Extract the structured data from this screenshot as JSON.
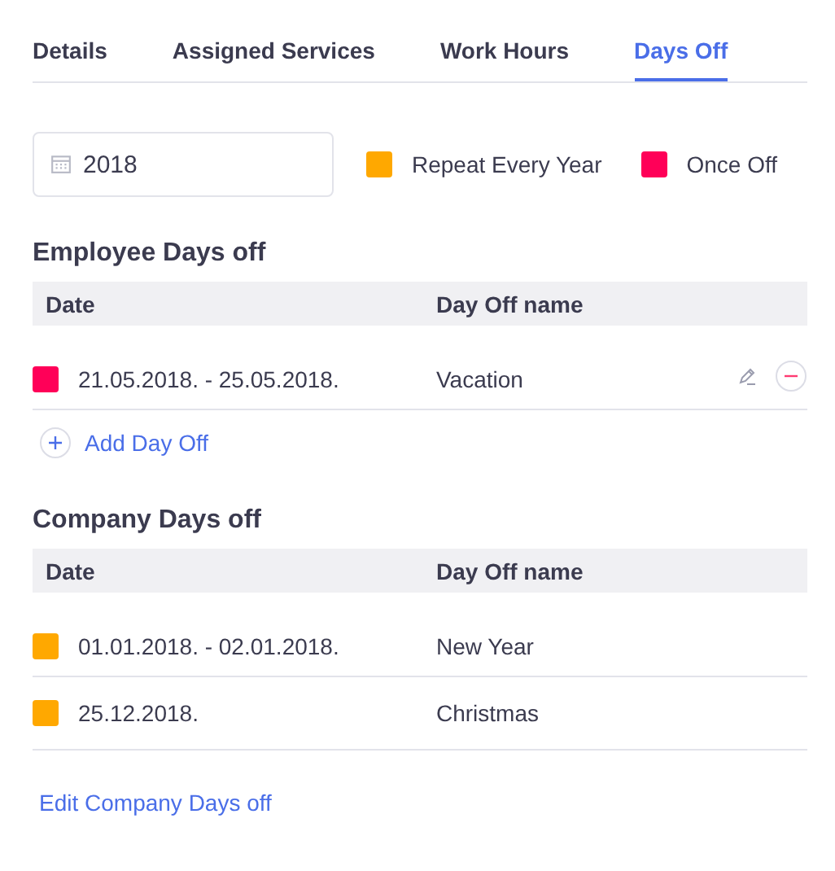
{
  "tabs": [
    {
      "label": "Details",
      "selected": false
    },
    {
      "label": "Assigned Services",
      "selected": false
    },
    {
      "label": "Work Hours",
      "selected": false
    },
    {
      "label": "Days Off",
      "selected": true
    }
  ],
  "year_field": {
    "value": "2018"
  },
  "legend": [
    {
      "label": "Repeat Every Year",
      "color": "#ffa800"
    },
    {
      "label": "Once Off",
      "color": "#ff0058"
    }
  ],
  "employee_days_off": {
    "title": "Employee Days off",
    "columns": [
      "Date",
      "Day Off name"
    ],
    "rows": [
      {
        "date": "21.05.2018. - 25.05.2018.",
        "name": "Vacation",
        "color": "#ff0058"
      }
    ],
    "add_link": "Add Day Off"
  },
  "company_days_off": {
    "title": "Company Days off",
    "columns": [
      "Date",
      "Day Off name"
    ],
    "rows": [
      {
        "date": "01.01.2018. - 02.01.2018.",
        "name": "New Year",
        "color": "#ffa800"
      },
      {
        "date": "25.12.2018.",
        "name": "Christmas",
        "color": "#ffa800"
      }
    ],
    "edit_link": "Edit Company Days off"
  }
}
